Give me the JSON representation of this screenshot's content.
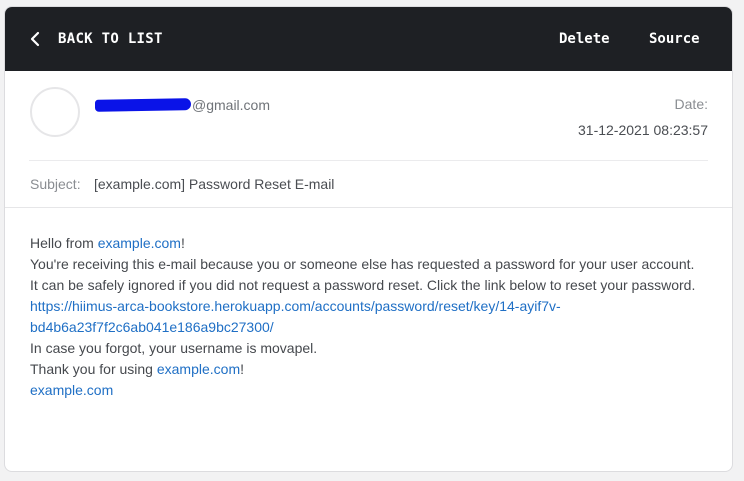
{
  "toolbar": {
    "back_label": "BACK TO LIST",
    "delete_label": "Delete",
    "source_label": "Source"
  },
  "header": {
    "sender_domain": "@gmail.com",
    "date_label": "Date:",
    "date_value": "31-12-2021 08:23:57",
    "subject_label": "Subject:",
    "subject_value": "[example.com] Password Reset E-mail"
  },
  "body": {
    "line1_prefix": "Hello from ",
    "line1_link": "example.com",
    "line1_suffix": "!",
    "line2": "You're receiving this e-mail because you or someone else has requested a password for your user account.",
    "line3": "It can be safely ignored if you did not request a password reset. Click the link below to reset your password.",
    "reset_link_part1": "https://hiimus-arca-bookstore.herokuapp.com/accounts/password/reset/key/14-ayif7v-",
    "reset_link_part2": "bd4b6a23f7f2c6ab041e186a9bc27300/",
    "line5": "In case you forgot, your username is movapel.",
    "line6_prefix": "Thank you for using ",
    "line6_link": "example.com",
    "line6_suffix": "!",
    "footer_link": "example.com"
  },
  "colors": {
    "topbar_bg": "#1e2024",
    "link": "#1f6fc5",
    "redaction": "#0a13e8"
  },
  "icons": {
    "back": "chevron-left-icon"
  }
}
